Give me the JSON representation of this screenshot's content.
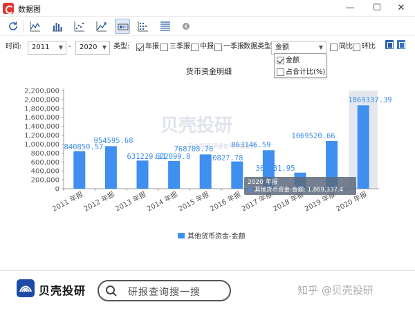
{
  "window": {
    "title": "数据图",
    "minimize": "—",
    "maximize": "☐",
    "close": "✕"
  },
  "toolbar": {
    "buttons": [
      "refresh-icon",
      "line-chart-icon",
      "bar-chart-icon",
      "scatter-chart-icon",
      "area-chart-icon",
      "heatmap-icon",
      "dot-matrix-icon",
      "table-icon",
      "back-icon"
    ],
    "active": "heatmap-icon"
  },
  "filters": {
    "time_label": "时间:",
    "start_year": "2011",
    "dash": "-",
    "end_year": "2020",
    "type_label": "类型:",
    "annual": {
      "label": "年报",
      "checked": true
    },
    "q3": {
      "label": "三季报",
      "checked": false
    },
    "interim": {
      "label": "中报",
      "checked": false
    },
    "q1": {
      "label": "一季报",
      "checked": false
    },
    "data_type_label": "数据类型",
    "data_type_value": "金额",
    "yoy": {
      "label": "同比",
      "checked": false
    },
    "qoq": {
      "label": "环比",
      "checked": false
    }
  },
  "dropdown": {
    "items": [
      {
        "label": "金额",
        "checked": true
      },
      {
        "label": "占合计比(%)",
        "checked": false
      }
    ]
  },
  "chart_data": {
    "type": "bar",
    "title": "货币资金明细",
    "categories": [
      "2011 年报",
      "2012 年报",
      "2013 年报",
      "2014 年报",
      "2015 年报",
      "2016 年报",
      "2017 年报",
      "2018 年报",
      "2019 年报",
      "2020 年报"
    ],
    "series": [
      {
        "name": "其他货币资金-金额",
        "values": [
          840850.57,
          954595.68,
          631229.31,
          622099.8,
          768708.76,
          610827.78,
          863146.59,
          360831.95,
          1069520.66,
          1869337.39
        ]
      }
    ],
    "data_labels": [
      "840850.57",
      "954595.68",
      "631229.31",
      "622099.8",
      "768708.76",
      "610827.78",
      "863146.59",
      "360831.95",
      "1069520.66",
      "1869337.39"
    ],
    "yticks": [
      "0",
      "200,000",
      "400,000",
      "600,000",
      "800,000",
      "1,000,000",
      "1,200,000",
      "1,400,000",
      "1,600,000",
      "1,800,000",
      "2,000,000",
      "2,200,000"
    ],
    "ylim": [
      0,
      2200000
    ],
    "legend": "bottom-center",
    "highlight_index": 9,
    "bar_color": "#3f8ff0",
    "highlight_band_color": "#e4e8ee",
    "tooltip": {
      "title": "2020 年报",
      "line": "其他货币资金-金额: 1,869,337.4"
    },
    "watermark": "贝壳投研",
    "watermark_sub": "贝壳投研 研报查询者都在用"
  },
  "footer": {
    "brand": "贝壳投研",
    "search_placeholder": "研报查询搜一搜",
    "credit": "知乎 @贝壳投研"
  }
}
